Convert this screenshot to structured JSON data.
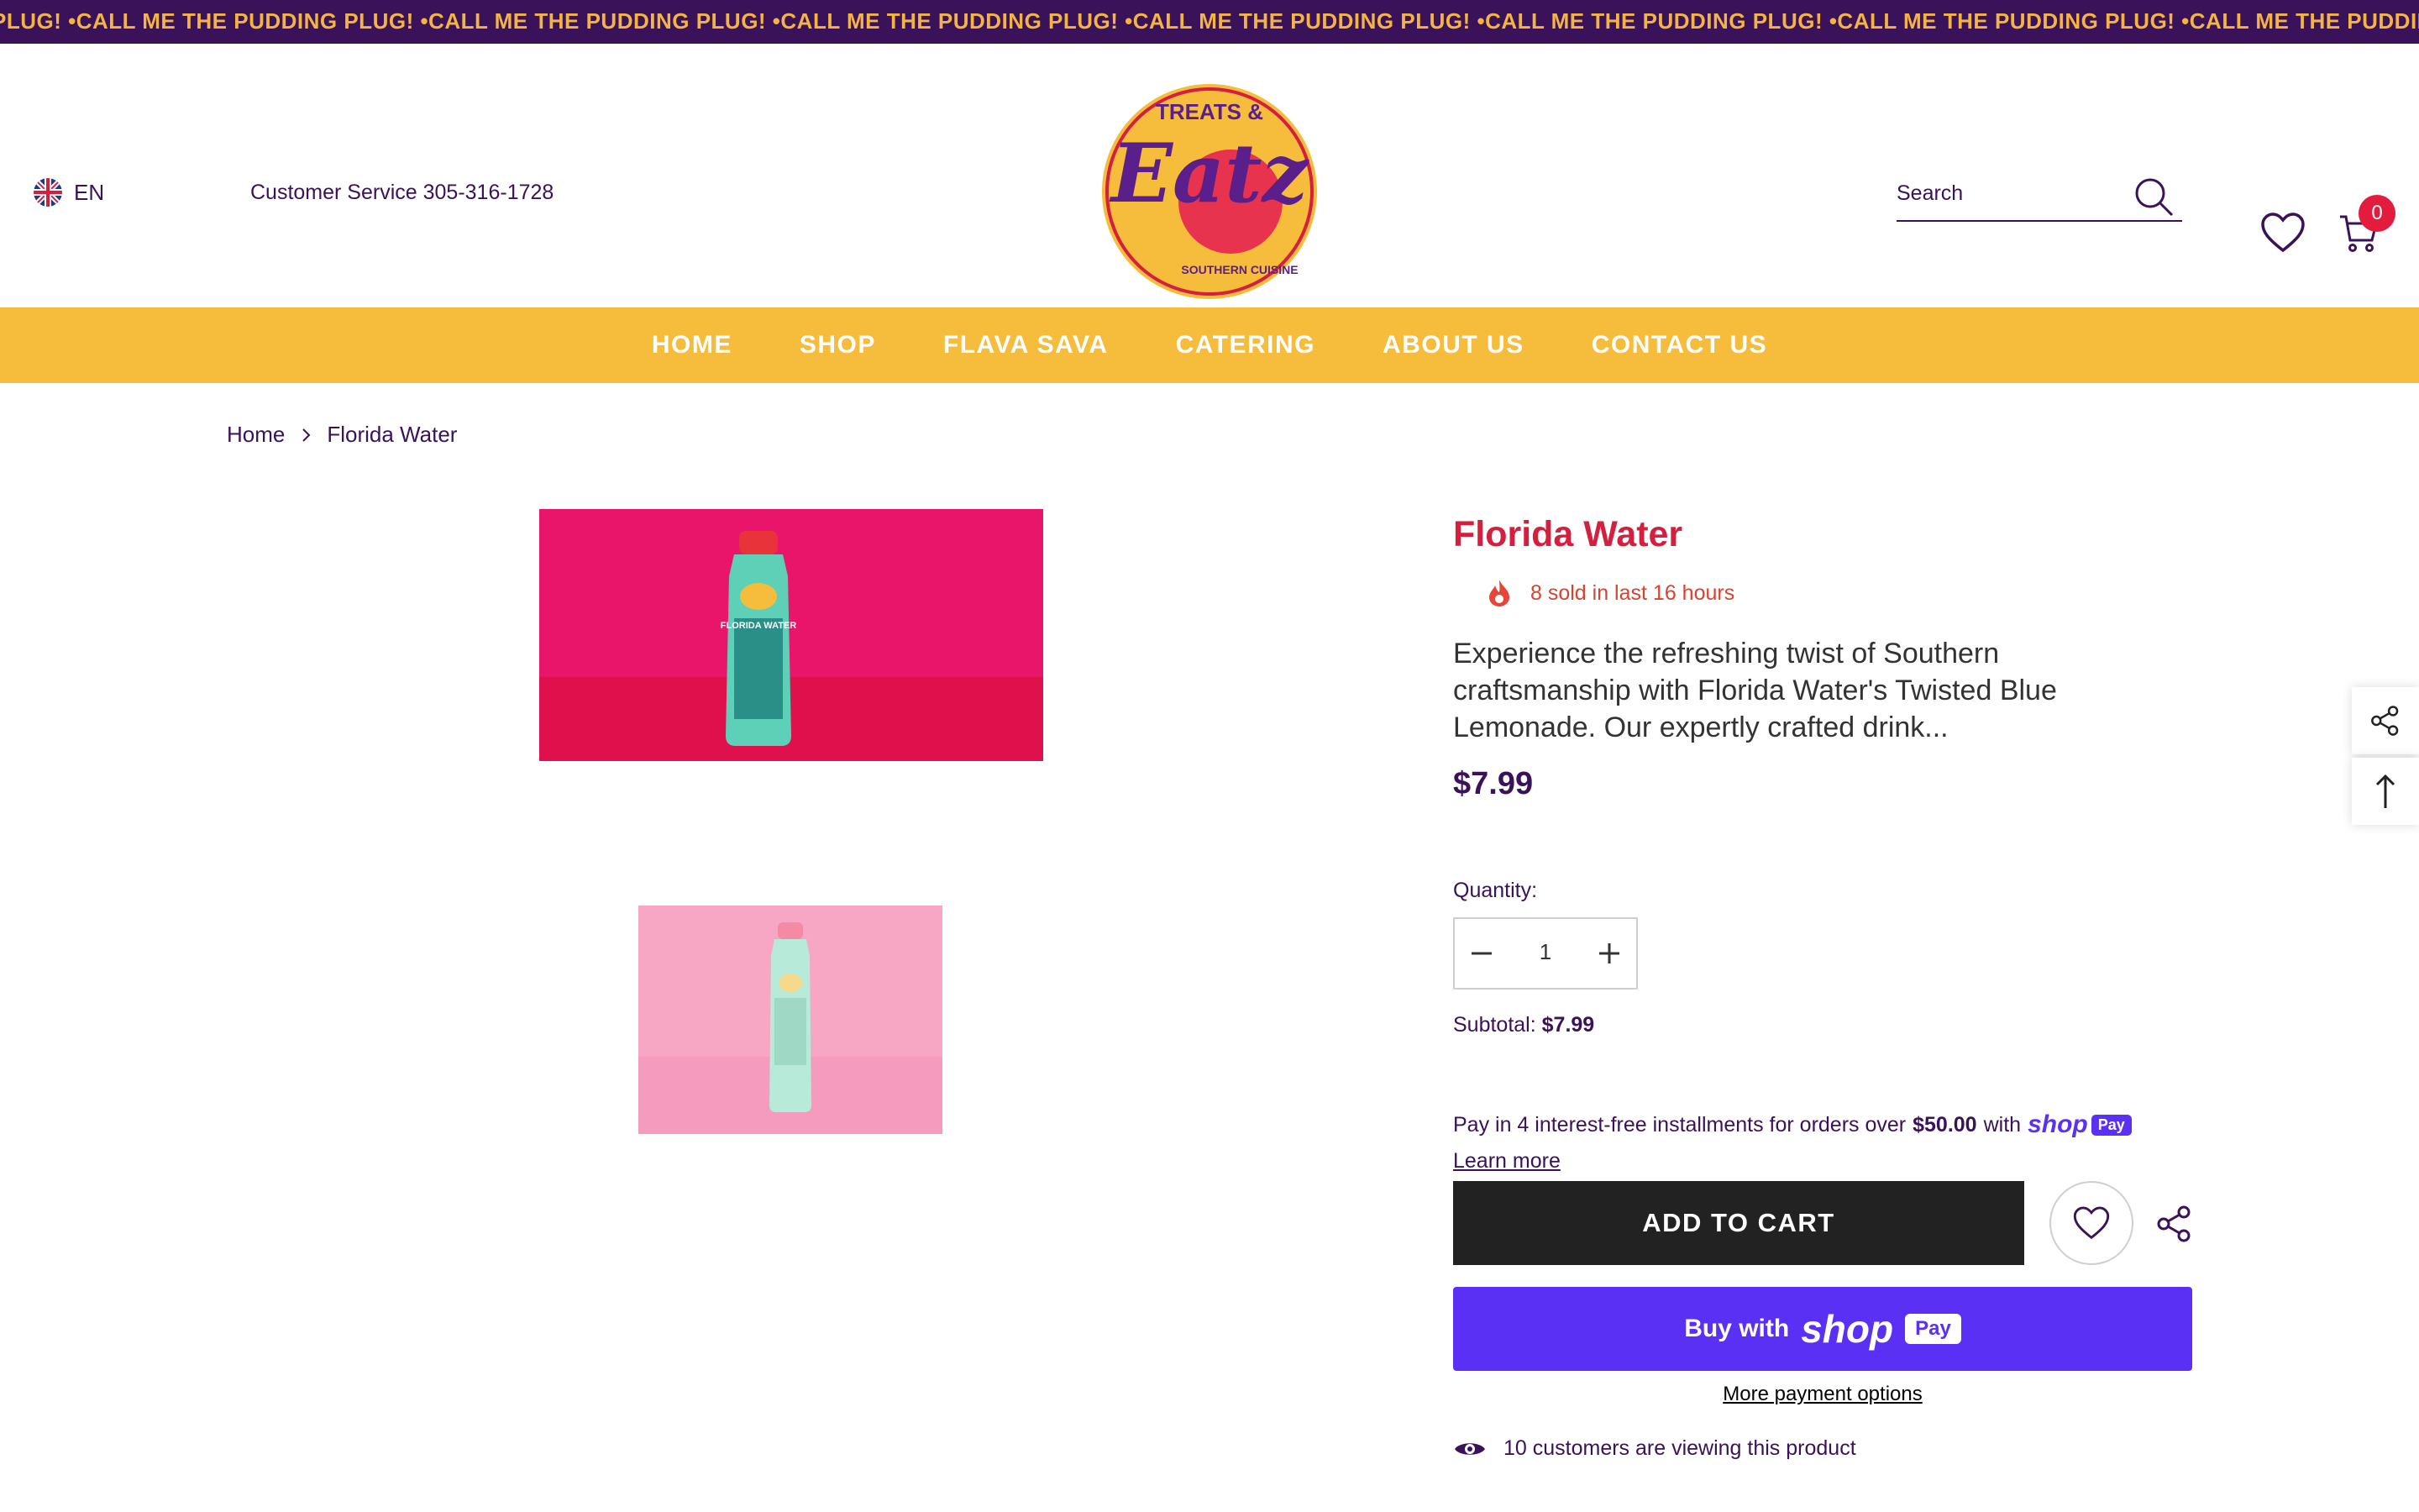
{
  "announcement": {
    "text": "PLUG! •CALL ME THE PUDDING PLUG! •CALL ME THE PUDDING PLUG! •CALL ME THE PUDDING PLUG! •CALL ME THE PUDDING PLUG! •CALL ME THE PUDDING PLUG! •CALL ME THE PUDDING PLUG! •CALL ME THE PUDDING PLUG!"
  },
  "header": {
    "language": "EN",
    "customer_service": "Customer Service 305-316-1728",
    "logo_text_top": "TREATS &",
    "logo_text_main": "Eatz",
    "logo_text_bottom": "SOUTHERN CUISINE",
    "search_placeholder": "Search",
    "cart_count": "0"
  },
  "nav": {
    "items": [
      "HOME",
      "SHOP",
      "FLAVA SAVA",
      "CATERING",
      "ABOUT US",
      "CONTACT US"
    ]
  },
  "breadcrumb": {
    "home": "Home",
    "current": "Florida Water"
  },
  "product": {
    "title": "Florida Water",
    "sold_text": "8 sold in last 16 hours",
    "description": "Experience the refreshing twist of Southern craftsmanship with Florida Water's Twisted Blue Lemonade. Our expertly crafted drink...",
    "price": "$7.99",
    "quantity_label": "Quantity:",
    "quantity_value": "1",
    "subtotal_label": "Subtotal:",
    "subtotal_value": "$7.99",
    "installments_prefix": "Pay in 4 interest-free installments for orders over",
    "installments_amount": "$50.00",
    "installments_with": "with",
    "shop_word": "shop",
    "pay_word": "Pay",
    "learn_more": "Learn more",
    "add_to_cart": "ADD TO CART",
    "buy_with": "Buy with",
    "more_payment": "More payment options",
    "viewing": "10 customers are viewing this product",
    "bottle_label": "FLORIDA WATER"
  },
  "colors": {
    "purple": "#3a1259",
    "gold": "#f6bc3b",
    "red": "#d41f3f",
    "shop_purple": "#5a31f4"
  }
}
